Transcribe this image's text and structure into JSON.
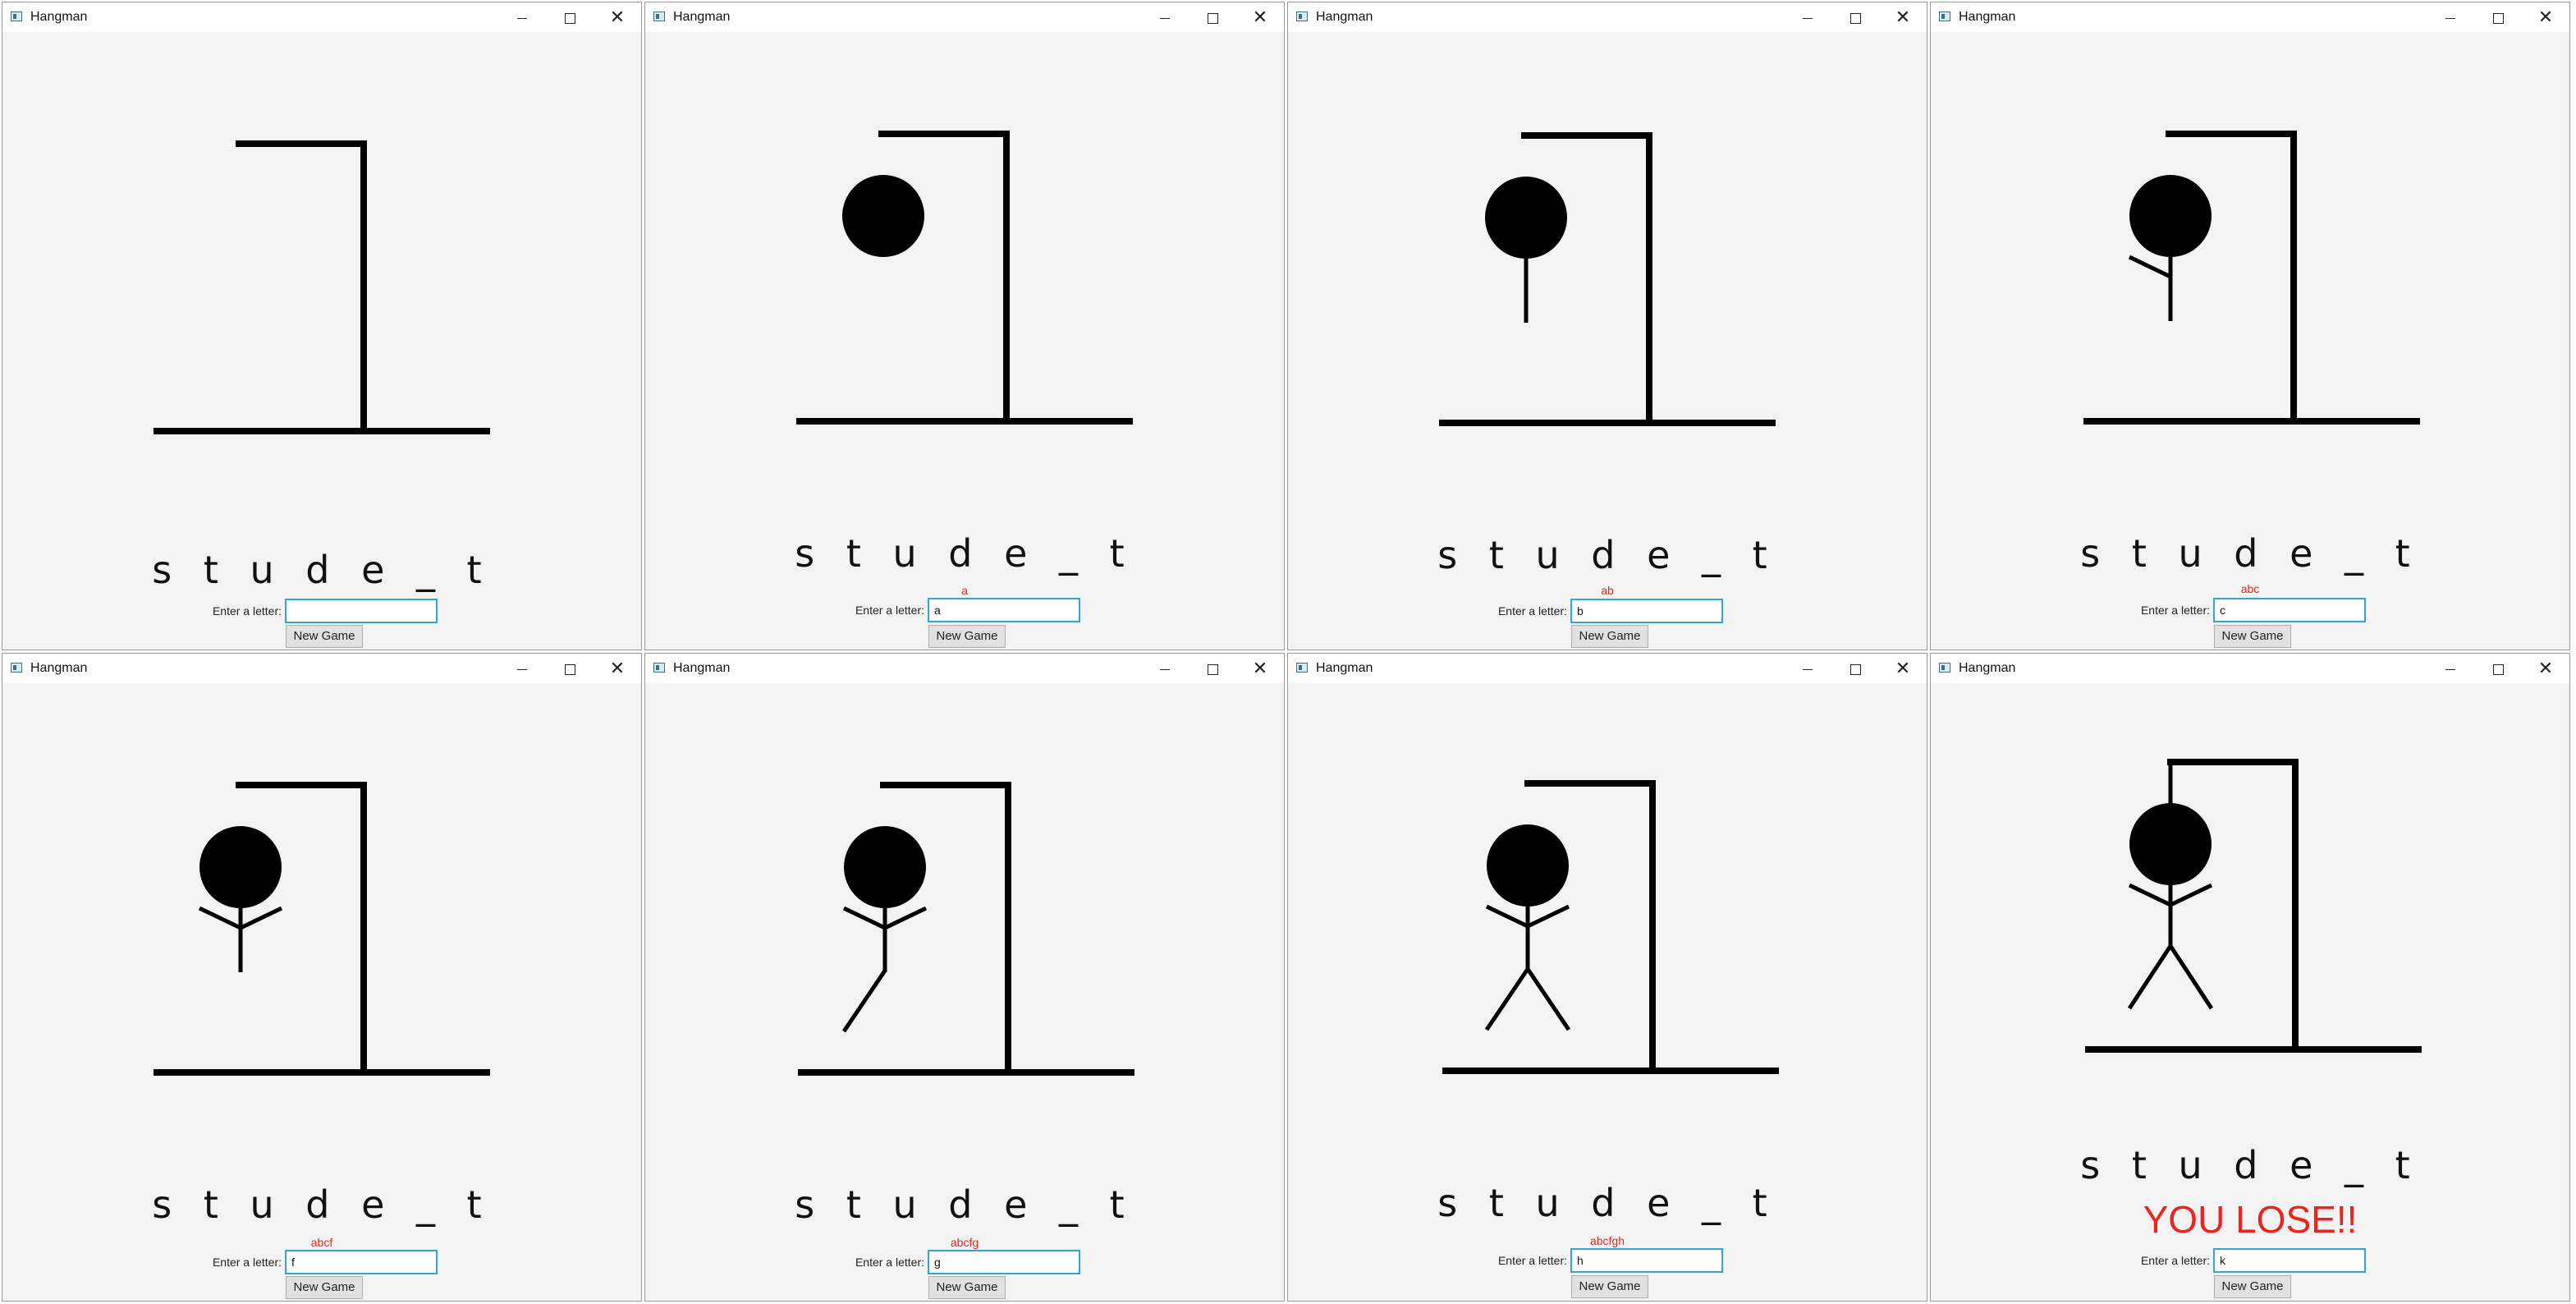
{
  "windows": [
    {
      "title": "Hangman",
      "word": "s t u d e _ t",
      "guessed": "",
      "input_value": "",
      "input_label": "Enter a letter:",
      "new_game_label": "New Game",
      "status": ""
    },
    {
      "title": "Hangman",
      "word": "s t u d e _ t",
      "guessed": "a",
      "input_value": "a",
      "input_label": "Enter a letter:",
      "new_game_label": "New Game",
      "status": ""
    },
    {
      "title": "Hangman",
      "word": "s t u d e _ t",
      "guessed": "ab",
      "input_value": "b",
      "input_label": "Enter a letter:",
      "new_game_label": "New Game",
      "status": ""
    },
    {
      "title": "Hangman",
      "word": "s t u d e _ t",
      "guessed": "abc",
      "input_value": "c",
      "input_label": "Enter a letter:",
      "new_game_label": "New Game",
      "status": ""
    },
    {
      "title": "Hangman",
      "word": "s t u d e _ t",
      "guessed": "abcf",
      "input_value": "f",
      "input_label": "Enter a letter:",
      "new_game_label": "New Game",
      "status": ""
    },
    {
      "title": "Hangman",
      "word": "s t u d e _ t",
      "guessed": "abcfg",
      "input_value": "g",
      "input_label": "Enter a letter:",
      "new_game_label": "New Game",
      "status": ""
    },
    {
      "title": "Hangman",
      "word": "s t u d e _ t",
      "guessed": "abcfgh",
      "input_value": "h",
      "input_label": "Enter a letter:",
      "new_game_label": "New Game",
      "status": ""
    },
    {
      "title": "Hangman",
      "word": "s t u d e _ t",
      "guessed": "",
      "input_value": "k",
      "input_label": "Enter a letter:",
      "new_game_label": "New Game",
      "status": "YOU LOSE!!"
    }
  ],
  "icons": {
    "app": "hangman-app-icon",
    "minimize": "minimize-icon",
    "maximize": "maximize-icon",
    "close": "close-icon"
  },
  "colors": {
    "accent_text": "#e8251e",
    "input_border": "#2fa5d6",
    "drawing": "#000000",
    "window_bg": "#f3f3f3"
  },
  "hangman_stages": [
    0,
    1,
    2,
    3,
    4,
    5,
    6,
    7
  ]
}
